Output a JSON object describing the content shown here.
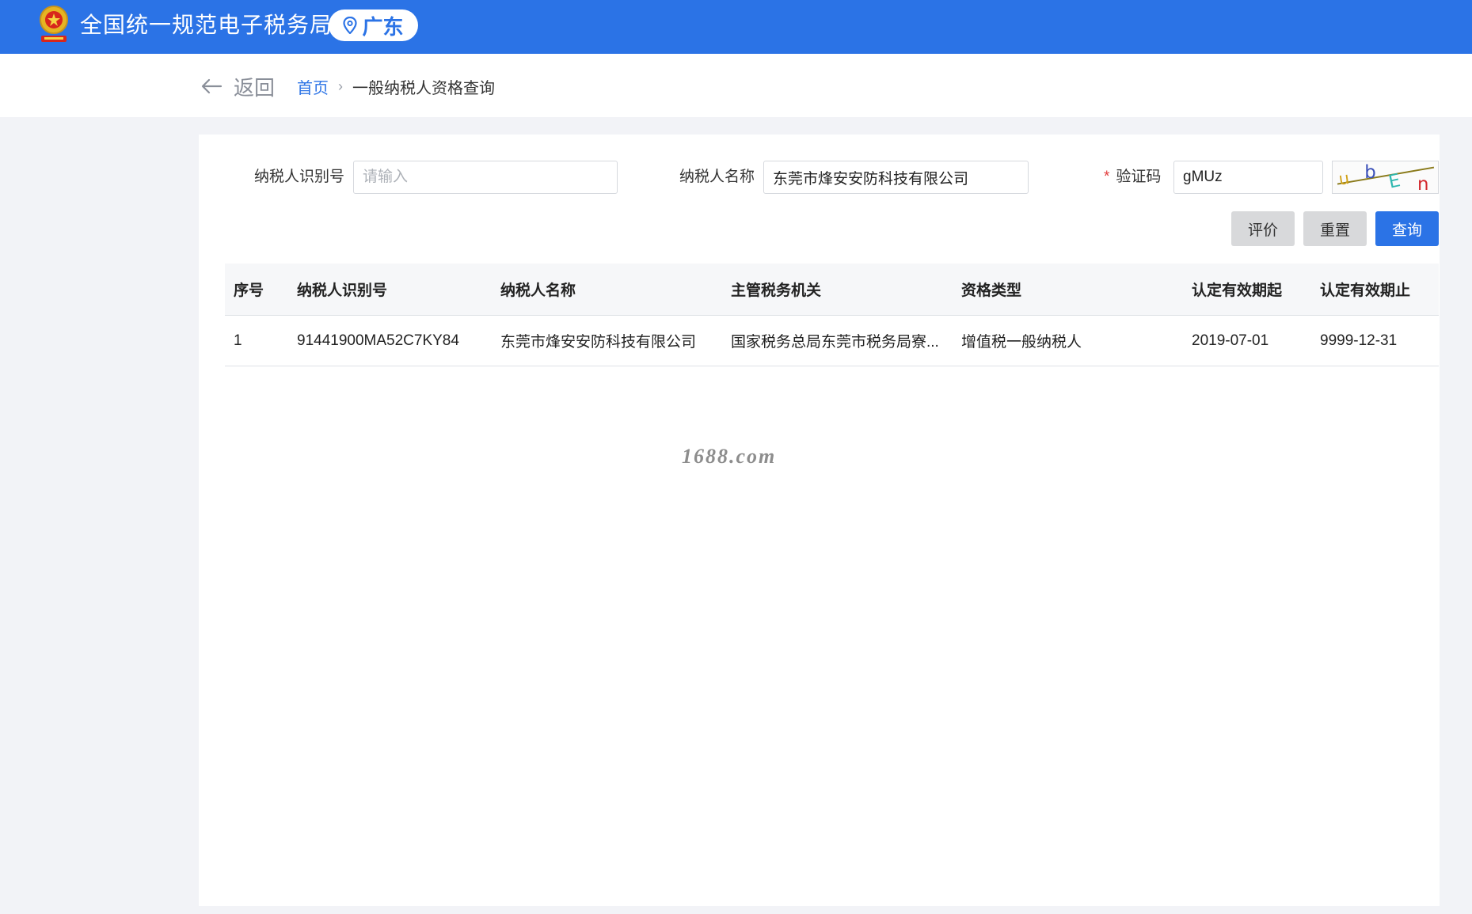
{
  "header": {
    "site_title": "全国统一规范电子税务局",
    "region": "广东",
    "brand_color": "#2b73e6",
    "emblem_icon": "national-emblem-icon",
    "location_icon": "map-pin-icon"
  },
  "breadcrumb": {
    "back_label": "返回",
    "home": "首页",
    "separator": "›",
    "current": "一般纳税人资格查询"
  },
  "form": {
    "taxpayer_id_label": "纳税人识别号",
    "taxpayer_id_placeholder": "请输入",
    "taxpayer_id_value": "",
    "taxpayer_name_label": "纳税人名称",
    "taxpayer_name_value": "东莞市烽安安防科技有限公司",
    "required_mark": "*",
    "captcha_label": "验证码",
    "captcha_value": "gMUz",
    "captcha_image_text": "ubEn"
  },
  "buttons": {
    "evaluate": "评价",
    "reset": "重置",
    "query": "查询"
  },
  "table": {
    "columns": [
      "序号",
      "纳税人识别号",
      "纳税人名称",
      "主管税务机关",
      "资格类型",
      "认定有效期起",
      "认定有效期止"
    ],
    "rows": [
      [
        "1",
        "91441900MA52C7KY84",
        "东莞市烽安安防科技有限公司",
        "国家税务总局东莞市税务局寮...",
        "增值税一般纳税人",
        "2019-07-01",
        "9999-12-31"
      ]
    ]
  },
  "watermark": "1688.com"
}
